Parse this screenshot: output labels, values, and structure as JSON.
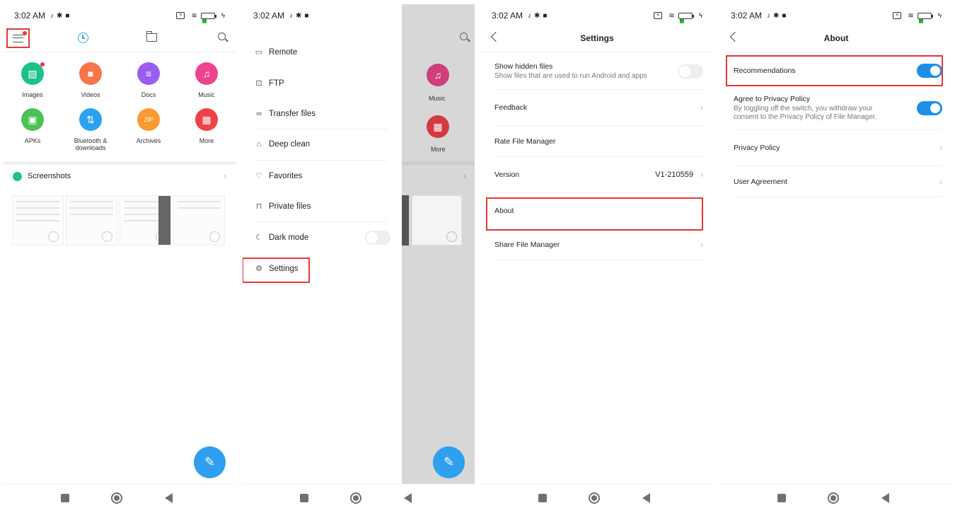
{
  "status_bar": {
    "time": "3:02 AM",
    "battery": "57"
  },
  "screen1": {
    "categories": [
      {
        "label": "Images",
        "icon": "image-icon",
        "color": "#1ec08b",
        "glyph": "▨"
      },
      {
        "label": "Videos",
        "icon": "video-icon",
        "color": "#f8744b",
        "glyph": "■"
      },
      {
        "label": "Docs",
        "icon": "document-icon",
        "color": "#9b5cf0",
        "glyph": "≡"
      },
      {
        "label": "Music",
        "icon": "music-icon",
        "color": "#f0438f",
        "glyph": "♫"
      },
      {
        "label": "APKs",
        "icon": "android-icon",
        "color": "#4cc256",
        "glyph": "▣"
      },
      {
        "label": "Bluetooth & downloads",
        "icon": "bluetooth-download-icon",
        "color": "#2aa3ec",
        "glyph": "⇅"
      },
      {
        "label": "Archives",
        "icon": "zip-icon",
        "color": "#fb9a32",
        "glyph": "ZIP"
      },
      {
        "label": "More",
        "icon": "grid-icon",
        "color": "#ef4147",
        "glyph": "▦"
      }
    ],
    "screenshots_label": "Screenshots"
  },
  "screen2": {
    "menu": [
      {
        "label": "Remote",
        "icon": "remote-icon",
        "glyph": "▭"
      },
      {
        "label": "FTP",
        "icon": "ftp-icon",
        "glyph": "⊡"
      },
      {
        "label": "Transfer files",
        "icon": "transfer-icon",
        "glyph": "∞"
      },
      {
        "label": "Deep clean",
        "icon": "deep-clean-icon",
        "glyph": "⌂"
      },
      {
        "label": "Favorites",
        "icon": "heart-icon",
        "glyph": "♡"
      },
      {
        "label": "Private files",
        "icon": "lock-icon",
        "glyph": "⊓"
      },
      {
        "label": "Dark mode",
        "icon": "moon-icon",
        "glyph": "☾"
      },
      {
        "label": "Settings",
        "icon": "gear-icon",
        "glyph": "⚙"
      }
    ],
    "dark_mode_on": false,
    "overlay": {
      "music": "Music",
      "more": "More"
    }
  },
  "screen3": {
    "title": "Settings",
    "show_hidden": {
      "title": "Show hidden files",
      "subtitle": "Show files that are used to run Android and apps",
      "on": false
    },
    "feedback": "Feedback",
    "rate": "Rate File Manager",
    "version_label": "Version",
    "version_value": "V1-210559",
    "about": "About",
    "share": "Share File Manager"
  },
  "screen4": {
    "title": "About",
    "recommendations": {
      "label": "Recommendations",
      "on": true
    },
    "privacy_agree": {
      "title": "Agree to Privacy Policy",
      "subtitle": "By toggling off the switch, you withdraw your consent to the Privacy Policy of File Manager.",
      "on": true
    },
    "privacy_policy": "Privacy Policy",
    "user_agreement": "User Agreement"
  }
}
